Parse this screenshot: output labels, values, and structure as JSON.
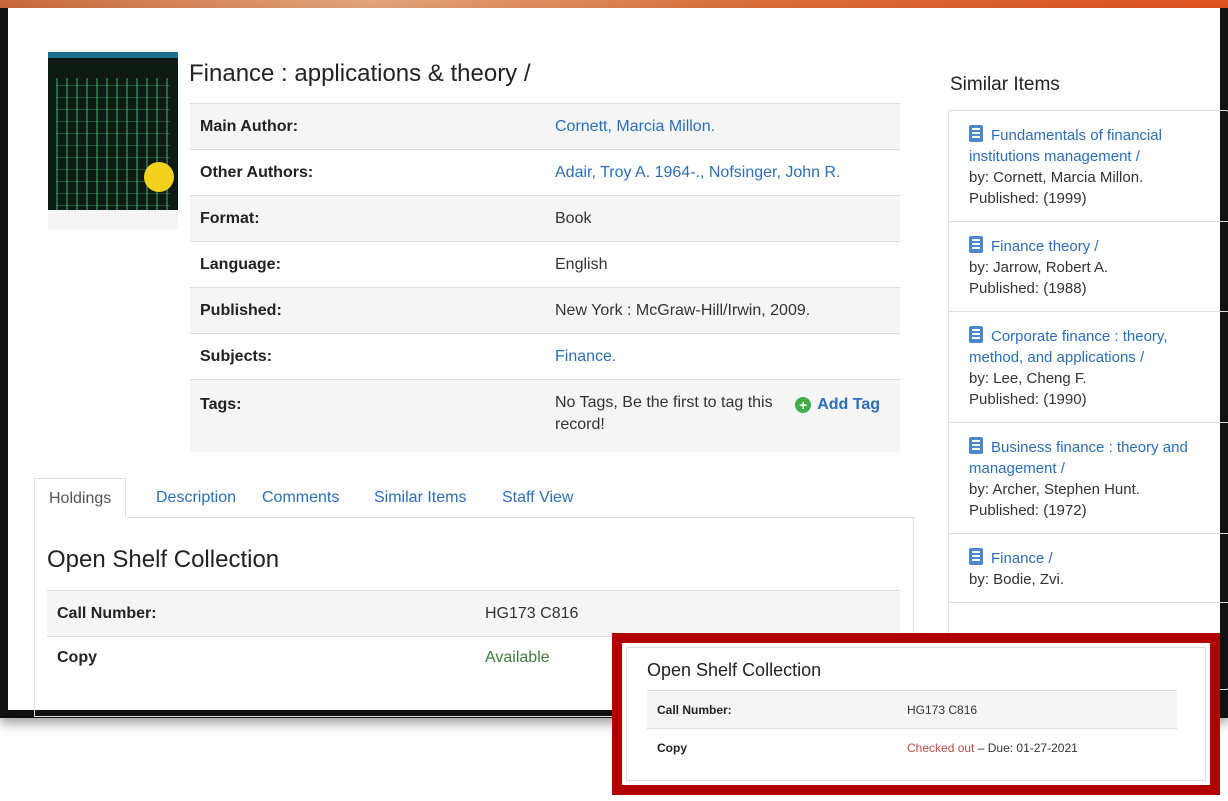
{
  "record": {
    "title": "Finance : applications & theory /",
    "details": [
      {
        "label": "Main Author:",
        "value": "Cornett, Marcia Millon.",
        "link": true
      },
      {
        "label": "Other Authors:",
        "value": "Adair, Troy A. 1964-., Nofsinger, John R.",
        "link": true
      },
      {
        "label": "Format:",
        "value": "Book",
        "link": false
      },
      {
        "label": "Language:",
        "value": "English",
        "link": false
      },
      {
        "label": "Published:",
        "value": "New York : McGraw-Hill/Irwin, 2009.",
        "link": false
      },
      {
        "label": "Subjects:",
        "value": "Finance.",
        "link": true
      }
    ],
    "tags": {
      "label": "Tags:",
      "value": "No Tags, Be the first to tag this record!",
      "add_label": "Add Tag"
    }
  },
  "tabs": [
    "Holdings",
    "Description",
    "Comments",
    "Similar Items",
    "Staff View"
  ],
  "holdings": {
    "heading": "Open Shelf Collection",
    "rows": [
      {
        "label": "Call Number:",
        "value": "HG173 C816"
      },
      {
        "label": "Copy",
        "value": "Available"
      }
    ]
  },
  "similar": {
    "heading": "Similar Items",
    "items": [
      {
        "title": "Fundamentals of financial institutions management /",
        "by": "by: Cornett, Marcia Millon.",
        "published": "Published: (1999)"
      },
      {
        "title": "Finance theory /",
        "by": "by: Jarrow, Robert A.",
        "published": "Published: (1988)"
      },
      {
        "title": "Corporate finance : theory, method, and applications /",
        "by": "by: Lee, Cheng F.",
        "published": "Published: (1990)"
      },
      {
        "title": "Business finance : theory and management /",
        "by": "by: Archer, Stephen Hunt.",
        "published": "Published: (1972)"
      },
      {
        "title": "Finance /",
        "by": "by: Bodie, Zvi.",
        "published": ""
      }
    ]
  },
  "callout": {
    "heading": "Open Shelf Collection",
    "call_label": "Call Number:",
    "call_value": "HG173 C816",
    "copy_label": "Copy",
    "status": "Checked out",
    "due": " – Due: 01-27-2021"
  },
  "colors": {
    "link": "#2a6ebb",
    "available": "#3c7d3c",
    "checked_out": "#b94a48",
    "callout_border": "#b20000"
  }
}
